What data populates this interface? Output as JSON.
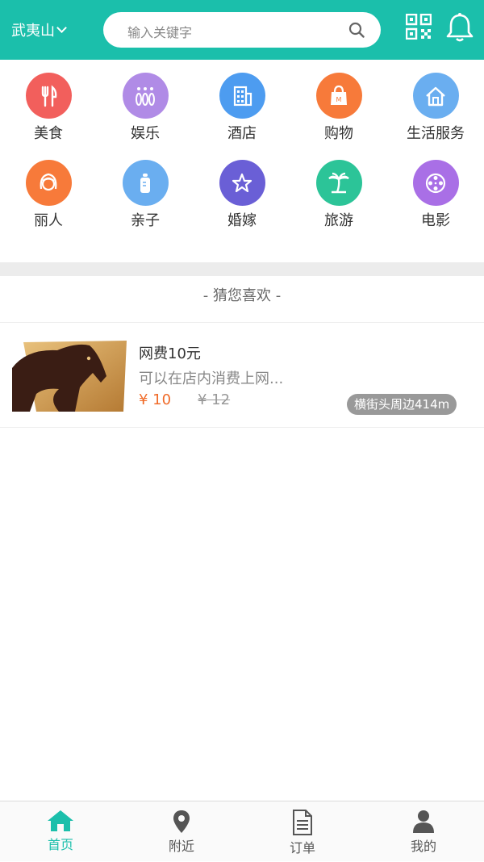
{
  "header": {
    "city": "武夷山",
    "search_placeholder": "输入关键字"
  },
  "categories": [
    {
      "label": "美食",
      "icon": "fork-knife-icon",
      "color": "#f25f5c"
    },
    {
      "label": "娱乐",
      "icon": "bowling-icon",
      "color": "#b08be6"
    },
    {
      "label": "酒店",
      "icon": "building-icon",
      "color": "#4d9cf0"
    },
    {
      "label": "购物",
      "icon": "shopping-bag-icon",
      "color": "#f77a3a"
    },
    {
      "label": "生活服务",
      "icon": "home-icon",
      "color": "#6aaef0"
    },
    {
      "label": "丽人",
      "icon": "woman-face-icon",
      "color": "#f77a3a"
    },
    {
      "label": "亲子",
      "icon": "baby-bottle-icon",
      "color": "#6aaef0"
    },
    {
      "label": "婚嫁",
      "icon": "star-icon",
      "color": "#6a5fd6"
    },
    {
      "label": "旅游",
      "icon": "palm-tree-icon",
      "color": "#2cc498"
    },
    {
      "label": "电影",
      "icon": "film-reel-icon",
      "color": "#a96fe6"
    }
  ],
  "section": {
    "guess_title": "- 猜您喜欢 -"
  },
  "product": {
    "title": "网费10元",
    "desc": "可以在店内消费上网...",
    "price": "¥ 10",
    "old_price": "¥ 12",
    "distance": "横街头周边414m"
  },
  "tabbar": {
    "items": [
      {
        "label": "首页",
        "icon": "home-icon",
        "active": true
      },
      {
        "label": "附近",
        "icon": "location-pin-icon",
        "active": false
      },
      {
        "label": "订单",
        "icon": "document-icon",
        "active": false
      },
      {
        "label": "我的",
        "icon": "user-icon",
        "active": false
      }
    ]
  },
  "colors": {
    "brand": "#1bbfab",
    "price": "#f06b29",
    "inactive_tab": "#555555"
  }
}
